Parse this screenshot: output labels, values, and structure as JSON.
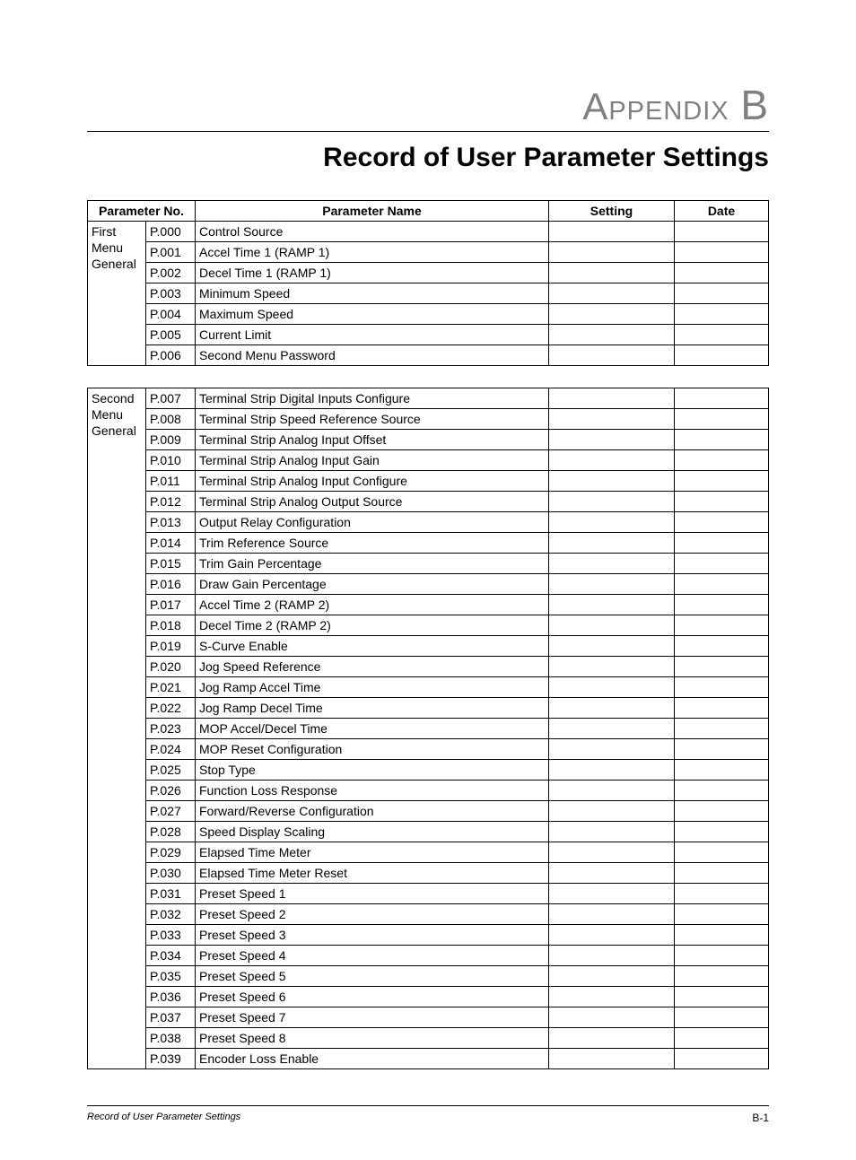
{
  "appendix_label": "Appendix",
  "appendix_letter": "B",
  "section_title": "Record of User Parameter Settings",
  "header": {
    "param_no": "Parameter No.",
    "param_name": "Parameter Name",
    "setting": "Setting",
    "date": "Date"
  },
  "groups": [
    {
      "label_lines": [
        "First",
        "Menu",
        "General"
      ],
      "rows": [
        {
          "no": "P.000",
          "name": "Control Source"
        },
        {
          "no": "P.001",
          "name": "Accel Time 1 (RAMP 1)"
        },
        {
          "no": "P.002",
          "name": "Decel Time 1 (RAMP 1)"
        },
        {
          "no": "P.003",
          "name": "Minimum Speed"
        },
        {
          "no": "P.004",
          "name": "Maximum Speed"
        },
        {
          "no": "P.005",
          "name": "Current Limit"
        },
        {
          "no": "P.006",
          "name": "Second Menu Password"
        }
      ]
    },
    {
      "label_lines": [
        "Second",
        "Menu",
        "General"
      ],
      "rows": [
        {
          "no": "P.007",
          "name": "Terminal Strip Digital Inputs Configure"
        },
        {
          "no": "P.008",
          "name": "Terminal Strip Speed Reference Source"
        },
        {
          "no": "P.009",
          "name": "Terminal Strip Analog Input Offset"
        },
        {
          "no": "P.010",
          "name": "Terminal Strip Analog Input Gain"
        },
        {
          "no": "P.011",
          "name": "Terminal Strip Analog Input Configure"
        },
        {
          "no": "P.012",
          "name": "Terminal Strip Analog Output Source"
        },
        {
          "no": "P.013",
          "name": "Output Relay Configuration"
        },
        {
          "no": "P.014",
          "name": "Trim Reference Source"
        },
        {
          "no": "P.015",
          "name": "Trim Gain Percentage"
        },
        {
          "no": "P.016",
          "name": "Draw Gain Percentage"
        },
        {
          "no": "P.017",
          "name": "Accel Time 2 (RAMP 2)"
        },
        {
          "no": "P.018",
          "name": "Decel Time 2 (RAMP 2)"
        },
        {
          "no": "P.019",
          "name": "S-Curve Enable"
        },
        {
          "no": "P.020",
          "name": "Jog Speed Reference"
        },
        {
          "no": "P.021",
          "name": "Jog Ramp Accel Time"
        },
        {
          "no": "P.022",
          "name": "Jog Ramp Decel Time"
        },
        {
          "no": "P.023",
          "name": "MOP Accel/Decel Time"
        },
        {
          "no": "P.024",
          "name": "MOP Reset Configuration"
        },
        {
          "no": "P.025",
          "name": "Stop Type"
        },
        {
          "no": "P.026",
          "name": "Function Loss Response"
        },
        {
          "no": "P.027",
          "name": "Forward/Reverse Configuration"
        },
        {
          "no": "P.028",
          "name": "Speed Display Scaling"
        },
        {
          "no": "P.029",
          "name": "Elapsed Time Meter"
        },
        {
          "no": "P.030",
          "name": "Elapsed Time Meter Reset"
        },
        {
          "no": "P.031",
          "name": "Preset Speed 1"
        },
        {
          "no": "P.032",
          "name": "Preset Speed 2"
        },
        {
          "no": "P.033",
          "name": "Preset Speed 3"
        },
        {
          "no": "P.034",
          "name": "Preset Speed 4"
        },
        {
          "no": "P.035",
          "name": "Preset Speed 5"
        },
        {
          "no": "P.036",
          "name": "Preset Speed 6"
        },
        {
          "no": "P.037",
          "name": "Preset Speed 7"
        },
        {
          "no": "P.038",
          "name": "Preset Speed 8"
        },
        {
          "no": "P.039",
          "name": "Encoder Loss Enable"
        }
      ]
    }
  ],
  "footer_left": "Record of User Parameter Settings",
  "footer_right": "B-1"
}
